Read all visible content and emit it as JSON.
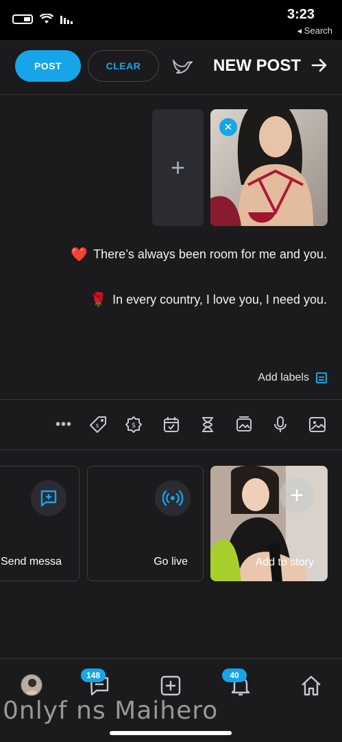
{
  "status_bar": {
    "time": "3:23",
    "back_label": "◂ Search"
  },
  "header": {
    "title": "NEW POST",
    "post_label": "POST",
    "clear_label": "CLEAR"
  },
  "composer": {
    "lines": [
      {
        "text": "There’s always been room for me and you.",
        "emoji": "❤️"
      },
      {
        "text": "In every country, I love you, I need you.",
        "emoji": "🌹"
      }
    ],
    "add_labels": "Add labels"
  },
  "cards": {
    "story": "Add to story",
    "live": "Go live",
    "message": "Send messa"
  },
  "nav": {
    "messages_badge": "148",
    "notifications_badge": "40"
  },
  "watermark": "0nlyf ns Maihero",
  "colors": {
    "accent": "#16a5e8",
    "background": "#1b1b1e"
  }
}
